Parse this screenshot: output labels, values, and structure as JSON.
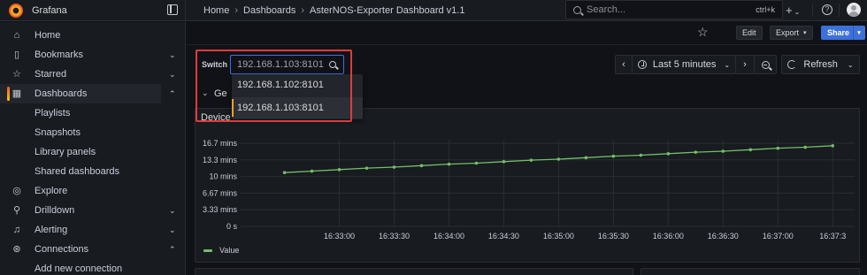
{
  "app": {
    "name": "Grafana"
  },
  "breadcrumbs": [
    "Home",
    "Dashboards",
    "AsterNOS-Exporter Dashboard v1.1"
  ],
  "search": {
    "placeholder": "Search...",
    "shortcut": "ctrl+k"
  },
  "sidebar": {
    "items": [
      {
        "label": "Home",
        "icon": "home-icon"
      },
      {
        "label": "Bookmarks",
        "icon": "bookmark-icon"
      },
      {
        "label": "Starred",
        "icon": "star-icon"
      },
      {
        "label": "Dashboards",
        "icon": "dashboards-icon"
      },
      {
        "label": "Explore",
        "icon": "explore-icon"
      },
      {
        "label": "Drilldown",
        "icon": "drilldown-icon"
      },
      {
        "label": "Alerting",
        "icon": "bell-icon"
      },
      {
        "label": "Connections",
        "icon": "connections-icon"
      }
    ],
    "dashboard_children": [
      "Playlists",
      "Snapshots",
      "Library panels",
      "Shared dashboards"
    ],
    "connections_children": [
      "Add new connection"
    ]
  },
  "toolbar": {
    "edit": "Edit",
    "export": "Export",
    "share": "Share"
  },
  "variable": {
    "label": "Switch",
    "value": "192.168.1.103:8101",
    "options": [
      "192.168.1.102:8101",
      "192.168.1.103:8101"
    ],
    "selected_index": 1
  },
  "time_picker": {
    "range": "Last 5 minutes",
    "refresh": "Refresh"
  },
  "row": {
    "title": "Ge"
  },
  "panel": {
    "title": "Device"
  },
  "colors": {
    "accent": "#3d71d9",
    "series": "#73bf69",
    "highlight": "#e03b3b"
  },
  "chart_data": {
    "type": "line",
    "yticks": [
      "16.7 mins",
      "13.3 mins",
      "10 mins",
      "6.67 mins",
      "3.33 mins",
      "0 s"
    ],
    "ylim": [
      0,
      16.7
    ],
    "xticks": [
      "16:33:00",
      "16:33:30",
      "16:34:00",
      "16:34:30",
      "16:35:00",
      "16:35:30",
      "16:36:00",
      "16:36:30",
      "16:37:00",
      "16:37:3"
    ],
    "xlim": [
      -0.9,
      4.7
    ],
    "x": [
      -0.5,
      -0.25,
      0.0,
      0.25,
      0.5,
      0.75,
      1.0,
      1.25,
      1.5,
      1.75,
      2.0,
      2.25,
      2.5,
      2.75,
      3.0,
      3.25,
      3.5,
      3.75,
      4.0,
      4.25,
      4.5
    ],
    "x_unit_note": "",
    "series": [
      {
        "name": "Value",
        "values": [
          10.8,
          11.1,
          11.4,
          11.7,
          11.9,
          12.2,
          12.5,
          12.7,
          13.0,
          13.3,
          13.5,
          13.8,
          14.1,
          14.3,
          14.6,
          14.9,
          15.1,
          15.4,
          15.7,
          15.9,
          16.2
        ]
      }
    ],
    "grid": true,
    "legend": "bottom-left"
  }
}
